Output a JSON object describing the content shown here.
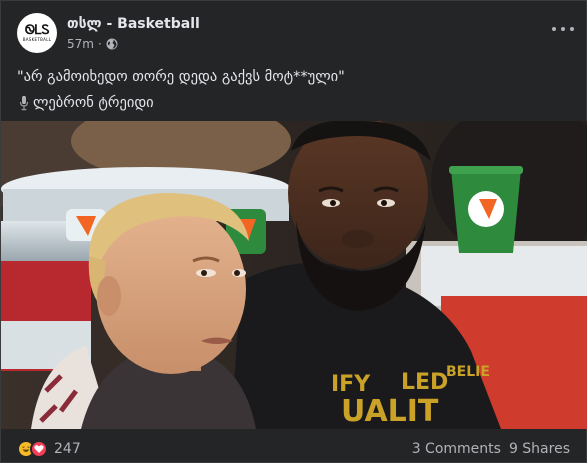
{
  "post": {
    "page_name": "თსლ",
    "separator": " - ",
    "group_name": "Basketball",
    "avatar_logo": "ᏫᏞᏚ",
    "avatar_sub": "BASKETBALL",
    "timestamp": "57m",
    "dot": "·",
    "privacy_icon": "globe-icon",
    "caption_line1": "\"არ გამოიხედო თორე დედა გაქვს მოტ**ული\"",
    "caption_line2": "ლებრონ ტრეიდი",
    "caption_emoji": "microphone-icon"
  },
  "footer": {
    "reaction_icons": [
      "haha-icon",
      "love-icon"
    ],
    "reaction_count": "247",
    "comments": "3 Comments",
    "shares": "9 Shares"
  },
  "colors": {
    "background": "#242526",
    "text_primary": "#e4e6eb",
    "text_secondary": "#b0b3b8",
    "haha": "#f7b928",
    "love": "#f33e58",
    "gatorade_green": "#2e8b3e",
    "gatorade_orange": "#f26522"
  }
}
